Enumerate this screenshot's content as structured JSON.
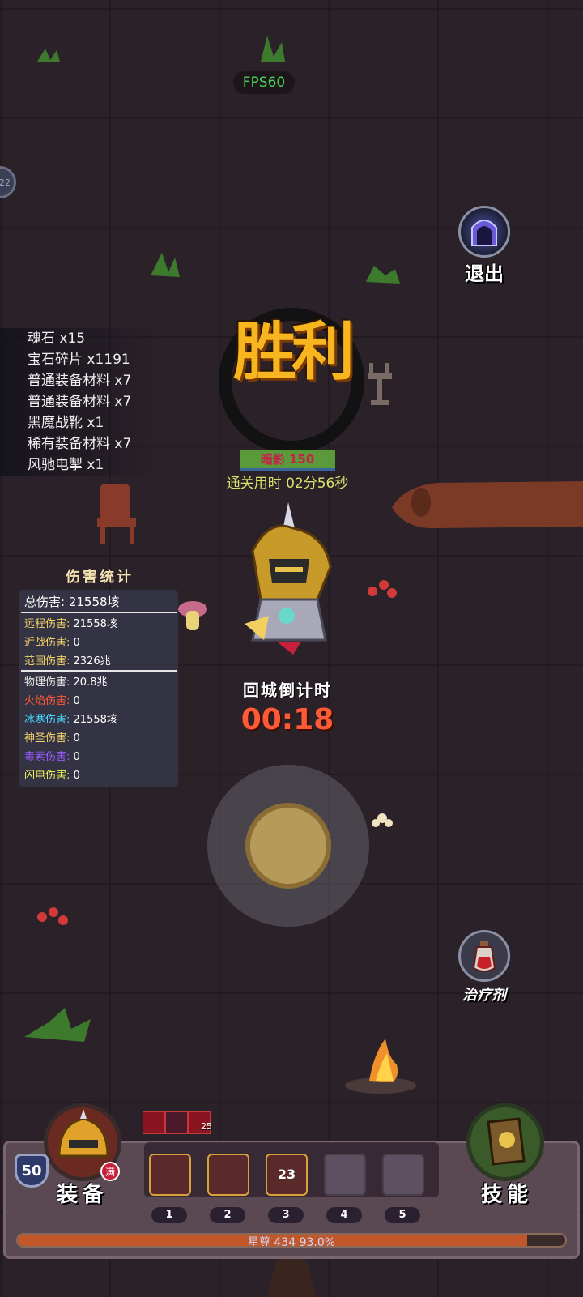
{
  "hud": {
    "fps": "FPS60",
    "edge_badge": "22"
  },
  "exit": {
    "label": "退出",
    "icon": "gate-icon"
  },
  "loot": [
    {
      "name": "魂石",
      "qty": "x15"
    },
    {
      "name": "宝石碎片",
      "qty": "x1191"
    },
    {
      "name": "普通装备材料",
      "qty": "x7"
    },
    {
      "name": "普通装备材料",
      "qty": "x7"
    },
    {
      "name": "黑魔战靴",
      "qty": "x1"
    },
    {
      "name": "稀有装备材料",
      "qty": "x7"
    },
    {
      "name": "风驰电掣",
      "qty": "x1"
    }
  ],
  "victory": {
    "title": "胜利",
    "rank_label": "暗影",
    "rank_value": "150",
    "clear_time_label": "通关用时",
    "clear_time": "02分56秒"
  },
  "damage_stats": {
    "title": "伤害统计",
    "total_label": "总伤害:",
    "total_value": "21558垓",
    "rows_a": [
      {
        "label": "远程伤害:",
        "value": "21558垓",
        "color": "#f2d36a"
      },
      {
        "label": "近战伤害:",
        "value": "0",
        "color": "#f2d36a"
      },
      {
        "label": "范围伤害:",
        "value": "2326兆",
        "color": "#f2d36a"
      }
    ],
    "rows_b": [
      {
        "label": "物理伤害:",
        "value": "20.8兆",
        "color": "#e6e6e6"
      },
      {
        "label": "火焰伤害:",
        "value": "0",
        "color": "#ff5a3a"
      },
      {
        "label": "冰寒伤害:",
        "value": "21558垓",
        "color": "#4ad9ff"
      },
      {
        "label": "神圣伤害:",
        "value": "0",
        "color": "#f2d36a"
      },
      {
        "label": "毒素伤害:",
        "value": "0",
        "color": "#9a5aff"
      },
      {
        "label": "闪电伤害:",
        "value": "0",
        "color": "#f2f25a"
      }
    ]
  },
  "return_timer": {
    "label": "回城倒计时",
    "value": "00:18"
  },
  "heal": {
    "label": "治疗剂"
  },
  "buffs": {
    "count": "25"
  },
  "equipment": {
    "label": "装备",
    "level": "50",
    "max_badge": "满"
  },
  "skills_button": {
    "label": "技能"
  },
  "skill_slots": [
    {
      "num": "1",
      "state": "filled",
      "count": ""
    },
    {
      "num": "2",
      "state": "filled",
      "count": ""
    },
    {
      "num": "3",
      "state": "filled",
      "count": "23"
    },
    {
      "num": "4",
      "state": "empty",
      "count": ""
    },
    {
      "num": "5",
      "state": "empty",
      "count": ""
    }
  ],
  "exp": {
    "label": "星尊 434",
    "percent_text": "93.0%",
    "fraction": 0.93
  }
}
